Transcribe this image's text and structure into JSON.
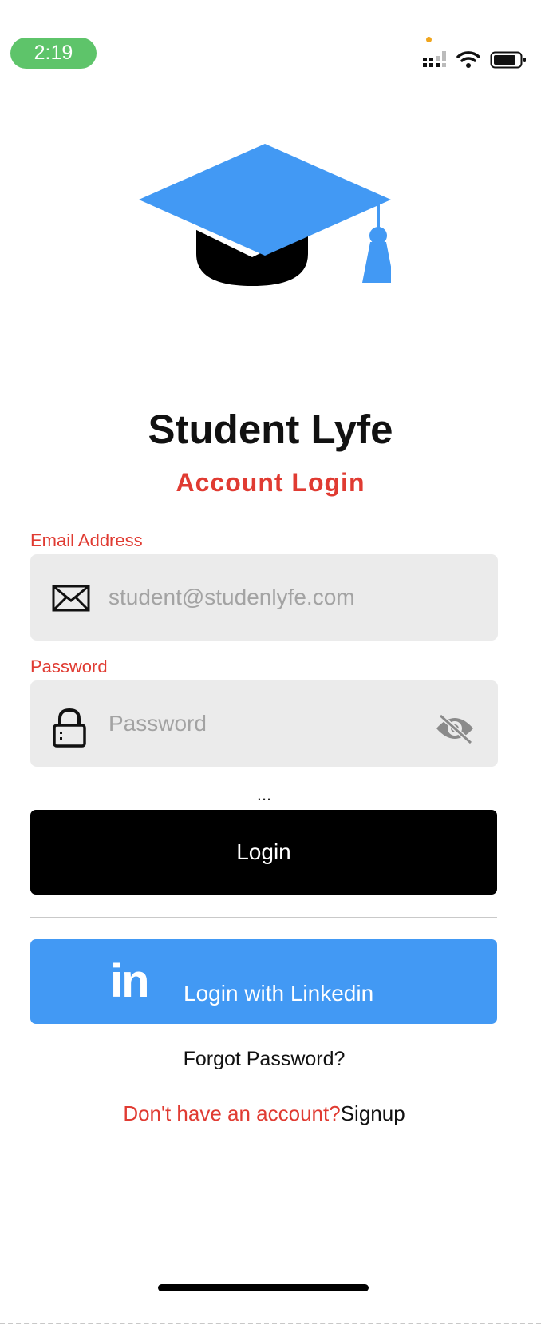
{
  "status_bar": {
    "time": "2:19",
    "time_pill_color": "#5ec46a",
    "icons": [
      "signal-icon",
      "wifi-icon",
      "battery-icon"
    ]
  },
  "hero": {
    "icon": "graduation-cap-icon",
    "icon_color": "#4299f4",
    "app_title": "Student Lyfe",
    "subtitle": "Account Login"
  },
  "form": {
    "email": {
      "label": "Email Address",
      "placeholder": "student@studenlyfe.com",
      "value": "",
      "icon": "mail-icon"
    },
    "password": {
      "label": "Password",
      "placeholder": "Password",
      "value": "",
      "icon": "lock-icon",
      "toggle_icon": "eye-off-icon"
    },
    "loading_indicator": "..."
  },
  "buttons": {
    "login": "Login",
    "linkedin_logo": "in",
    "linkedin": "Login with Linkedin"
  },
  "links": {
    "forgot_password": "Forgot Password?",
    "no_account": "Don't have an account?",
    "signup": "Signup"
  },
  "colors": {
    "accent_red": "#e03b32",
    "linkedin_blue": "#4299f4",
    "field_bg": "#ebebeb"
  }
}
